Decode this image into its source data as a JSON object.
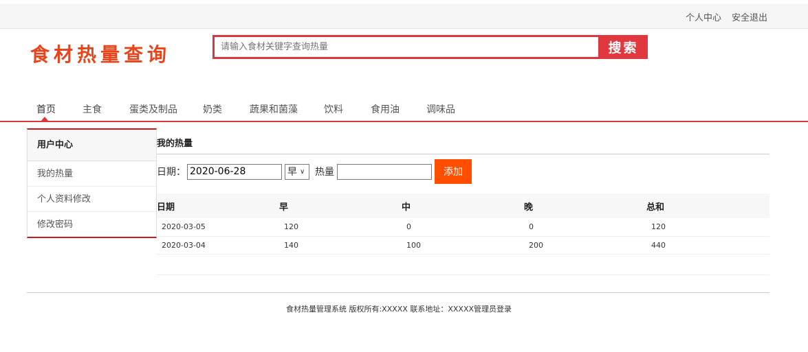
{
  "topbar": {
    "user_center": "个人中心",
    "logout": "安全退出"
  },
  "logo": "食材热量查询",
  "search": {
    "placeholder": "请输入食材关键字查询热量",
    "button": "搜索"
  },
  "nav": [
    "首页",
    "主食",
    "蛋类及制品",
    "奶类",
    "蔬果和菌藻",
    "饮料",
    "食用油",
    "调味品"
  ],
  "sidebar": {
    "title": "用户中心",
    "items": [
      "我的热量",
      "个人资料修改",
      "修改密码"
    ]
  },
  "main": {
    "title": "我的热量",
    "form": {
      "date_label": "日期：",
      "date_value": "2020-06-28",
      "meal_value": "早",
      "calorie_label": "热量",
      "add_button": "添加"
    },
    "table": {
      "headers": [
        "日期",
        "早",
        "中",
        "晚",
        "总和"
      ],
      "rows": [
        [
          "2020-03-05",
          "120",
          "0",
          "0",
          "120"
        ],
        [
          "2020-03-04",
          "140",
          "100",
          "200",
          "440"
        ]
      ]
    }
  },
  "footer": "食材热量管理系统 版权所有:XXXXX 联系地址：XXXXX管理员登录",
  "colors": {
    "accent": "#d9363e",
    "add_button": "#ff4e00"
  }
}
